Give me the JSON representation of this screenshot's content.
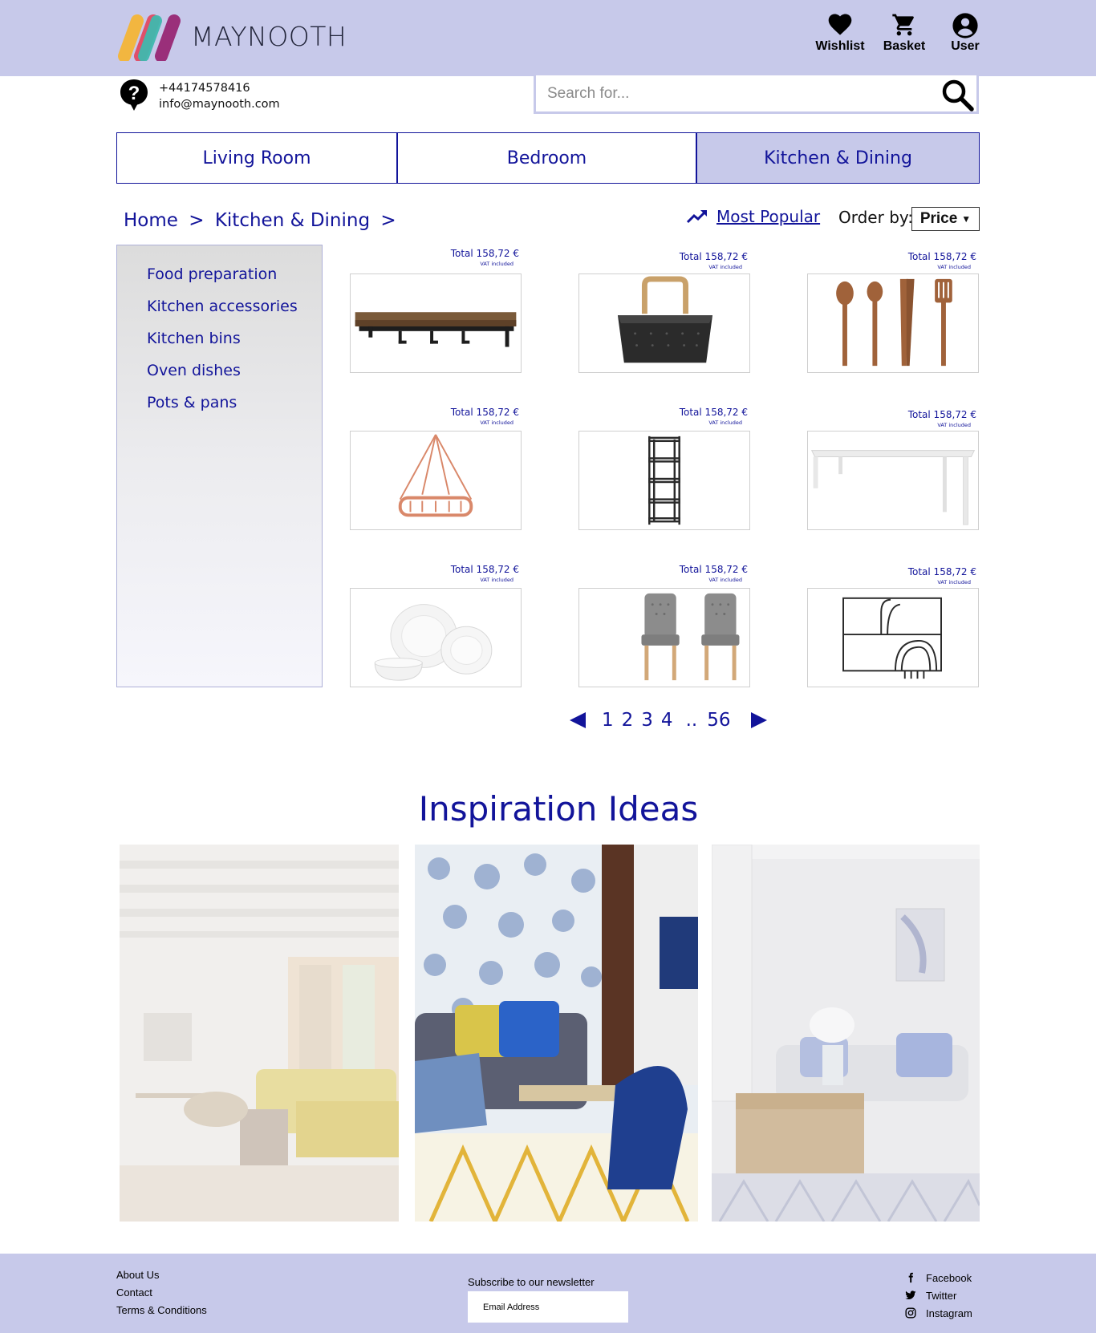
{
  "header": {
    "brand": "MAYNOOTH",
    "actions": {
      "wishlist": "Wishlist",
      "basket": "Basket",
      "user": "User"
    }
  },
  "contact": {
    "phone": "+44174578416",
    "email": "info@maynooth.com"
  },
  "search": {
    "placeholder": "Search for..."
  },
  "categories": [
    "Living Room",
    "Bedroom",
    "Kitchen & Dining"
  ],
  "active_category": "Kitchen & Dining",
  "breadcrumb": {
    "home": "Home",
    "sep": ">",
    "current": "Kitchen & Dining"
  },
  "sort": {
    "popular_label": "Most Popular",
    "order_label": "Order by:",
    "order_value": "Price"
  },
  "sidebar": {
    "items": [
      "Food preparation",
      "Kitchen accessories",
      "Kitchen bins",
      "Oven dishes",
      "Pots & pans"
    ]
  },
  "products": [
    {
      "price": "Total 158,72 €",
      "vat": "VAT included",
      "item": "wall shelf with hooks"
    },
    {
      "price": "Total 158,72 €",
      "vat": "VAT included",
      "item": "wire basket"
    },
    {
      "price": "Total 158,72 €",
      "vat": "VAT included",
      "item": "wooden utensils"
    },
    {
      "price": "Total 158,72 €",
      "vat": "VAT included",
      "item": "hanging pot rack"
    },
    {
      "price": "Total 158,72 €",
      "vat": "VAT included",
      "item": "wire shelving unit"
    },
    {
      "price": "Total 158,72 €",
      "vat": "VAT included",
      "item": "white dining table"
    },
    {
      "price": "Total 158,72 €",
      "vat": "VAT included",
      "item": "white dinnerware"
    },
    {
      "price": "Total 158,72 €",
      "vat": "VAT included",
      "item": "grey dining chairs"
    },
    {
      "price": "Total 158,72 €",
      "vat": "VAT included",
      "item": "wall dish rack"
    }
  ],
  "pagination": {
    "pages": [
      "1",
      "2",
      "3",
      "4"
    ],
    "ellipsis": "..",
    "last": "56"
  },
  "inspiration": {
    "title": "Inspiration Ideas"
  },
  "footer": {
    "links": [
      "About Us",
      "Contact",
      "Terms & Conditions"
    ],
    "newsletter_label": "Subscribe to our newsletter",
    "newsletter_placeholder": "Email Address",
    "social": [
      "Facebook",
      "Twitter",
      "Instagram"
    ]
  },
  "colors": {
    "primary": "#12149a",
    "band": "#c7c9ea"
  }
}
